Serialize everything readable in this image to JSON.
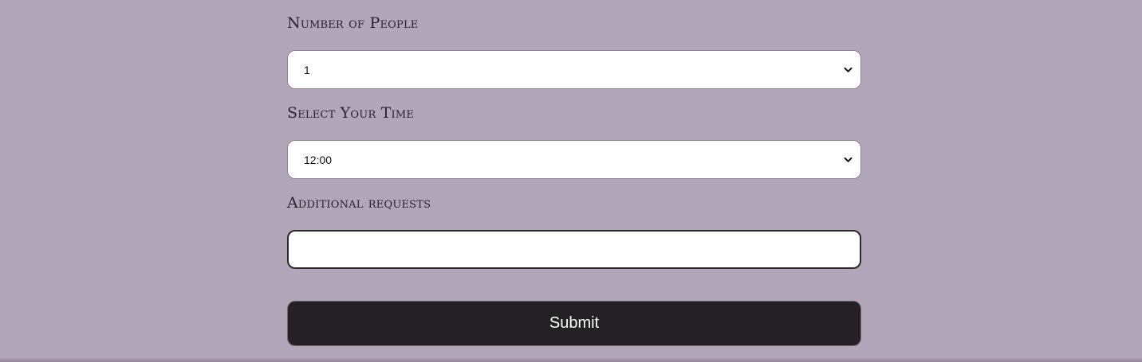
{
  "form": {
    "people": {
      "label": "Number of People",
      "selected_value": "1"
    },
    "time": {
      "label": "Select Your Time",
      "selected_value": "12:00"
    },
    "requests": {
      "label": "Additional requests",
      "value": ""
    },
    "submit_label": "Submit"
  },
  "colors": {
    "background": "#b2a6b9",
    "submit_button": "#232123",
    "field_background": "#ffffff"
  }
}
